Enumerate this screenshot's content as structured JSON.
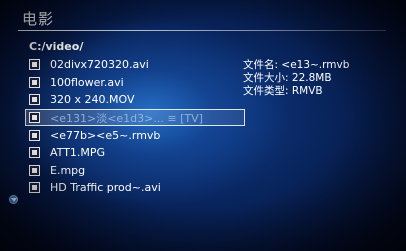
{
  "title": "电影",
  "current_path": "C:/video/",
  "files": [
    {
      "name": "02divx720320.avi"
    },
    {
      "name": "100flower.avi"
    },
    {
      "name": "320 x 240.MOV"
    },
    {
      "name": "<e131>淡<e1d3>... ≡ [TV]"
    },
    {
      "name": "<e77b><e5~.rmvb"
    },
    {
      "name": "ATT1.MPG"
    },
    {
      "name": "E.mpg"
    },
    {
      "name": "HD Traffic prod~.avi"
    }
  ],
  "selected_index": 3,
  "file_info": {
    "name_label": "文件名:",
    "name_value": "<e13~.rmvb",
    "size_label": "文件大小:",
    "size_value": "22.8MB",
    "type_label": "文件类型:",
    "type_value": "RMVB"
  },
  "icons": {
    "file_icon": "video-file-icon",
    "scroll_icon": "scroll-down-icon"
  },
  "colors": {
    "background_center": "#1d6fd0",
    "background_edge": "#01040e",
    "text": "#ffffff",
    "scroll_indicator": "#2e7ee0"
  }
}
